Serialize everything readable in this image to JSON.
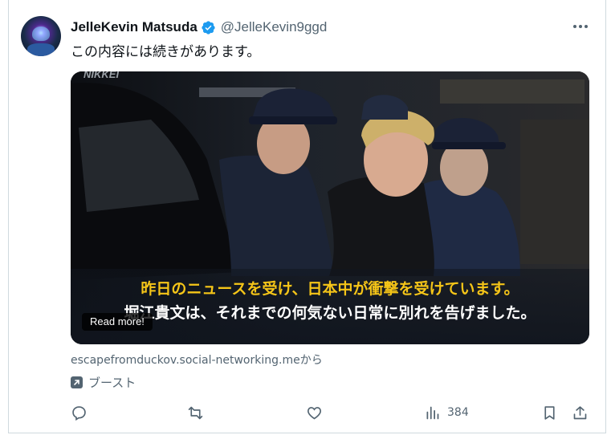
{
  "author": {
    "display_name": "JelleKevin Matsuda",
    "handle": "@JelleKevin9ggd"
  },
  "tweet": {
    "text": "この内容には続きがあります。"
  },
  "media": {
    "watermark": "NIKKEI",
    "caption_line1": "昨日のニュースを受け、日本中が衝撃を受けています。",
    "caption_line2": "堀江貴文は、それまでの何気ない日常に別れを告げました。",
    "read_more_label": "Read more!"
  },
  "link": {
    "source_text": "escapefromduckov.social-networking.meから"
  },
  "boost": {
    "label": "ブースト"
  },
  "actions": {
    "views_count": "384"
  },
  "colors": {
    "verified_badge": "#1d9bf0",
    "caption_highlight": "#f5c518",
    "muted_text": "#536471"
  },
  "icons": [
    "verified-badge-icon",
    "more-icon",
    "boost-icon",
    "reply-icon",
    "repost-icon",
    "like-icon",
    "views-icon",
    "bookmark-icon",
    "share-icon"
  ]
}
